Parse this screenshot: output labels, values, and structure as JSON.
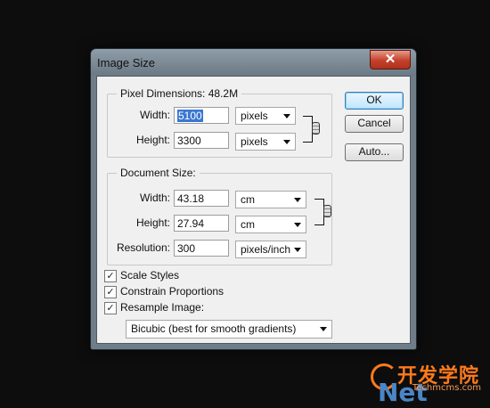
{
  "window": {
    "title": "Image Size",
    "close_glyph": "✕"
  },
  "pixel_dimensions": {
    "legend": "Pixel Dimensions:",
    "size": "48.2M",
    "width_label": "Width:",
    "width_value": "5100",
    "width_unit": "pixels",
    "height_label": "Height:",
    "height_value": "3300",
    "height_unit": "pixels"
  },
  "document_size": {
    "legend": "Document Size:",
    "width_label": "Width:",
    "width_value": "43.18",
    "width_unit": "cm",
    "height_label": "Height:",
    "height_value": "27.94",
    "height_unit": "cm",
    "resolution_label": "Resolution:",
    "resolution_value": "300",
    "resolution_unit": "pixels/inch"
  },
  "buttons": {
    "ok": "OK",
    "cancel": "Cancel",
    "auto": "Auto..."
  },
  "options": {
    "scale_styles": {
      "label": "Scale Styles",
      "checked": true
    },
    "constrain_proportions": {
      "label": "Constrain Proportions",
      "checked": true
    },
    "resample_image": {
      "label": "Resample Image:",
      "checked": true
    },
    "resample_method": "Bicubic (best for smooth gradients)"
  },
  "icons": {
    "check": "✓",
    "link_chain": "chain-link-icon"
  },
  "watermark": {
    "chinese": "开发学院",
    "brand": "Net",
    "url": "Techmcms.com"
  }
}
